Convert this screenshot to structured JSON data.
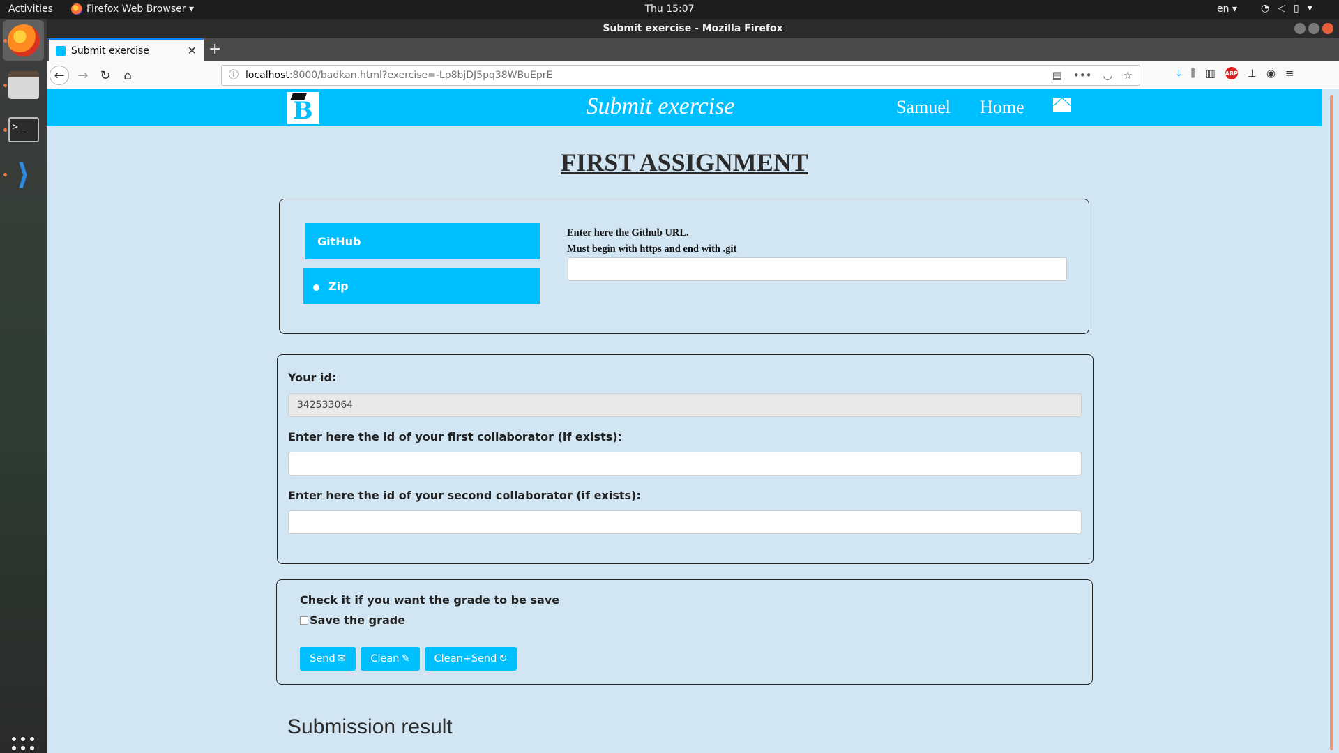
{
  "system_bar": {
    "activities": "Activities",
    "app_menu": "Firefox Web Browser ▾",
    "clock": "Thu 15:07",
    "language": "en ▾"
  },
  "browser": {
    "window_title": "Submit exercise - Mozilla Firefox",
    "tab_title": "Submit exercise",
    "url_host": "localhost",
    "url_rest": ":8000/badkan.html?exercise=-Lp8bjDJ5pq38WBuEprE"
  },
  "header": {
    "title": "Submit exercise",
    "user_link": "Samuel",
    "home_link": "Home"
  },
  "page": {
    "title": "FIRST ASSIGNMENT"
  },
  "submission_type": {
    "github_label": "GitHub",
    "zip_label": "Zip",
    "selected": "Zip",
    "github_url_hint_line1": "Enter here the Github URL.",
    "github_url_hint_line2": "Must begin with https and end with .git",
    "github_url_value": ""
  },
  "ids": {
    "your_id_label": "Your id:",
    "your_id_value": "342533064",
    "collab1_label": "Enter here the id of your first collaborator (if exists):",
    "collab1_value": "",
    "collab2_label": "Enter here the id of your second collaborator (if exists):",
    "collab2_value": ""
  },
  "grade": {
    "check_title": "Check it if you want the grade to be save",
    "checkbox_label": "Save the grade",
    "checked": false
  },
  "actions": {
    "send_label": "Send",
    "clean_label": "Clean",
    "clean_send_label": "Clean+Send"
  },
  "result": {
    "title": "Submission result"
  },
  "colors": {
    "brand": "#00bfff",
    "page_background": "#d1e5f2",
    "panel_border": "#222222"
  }
}
